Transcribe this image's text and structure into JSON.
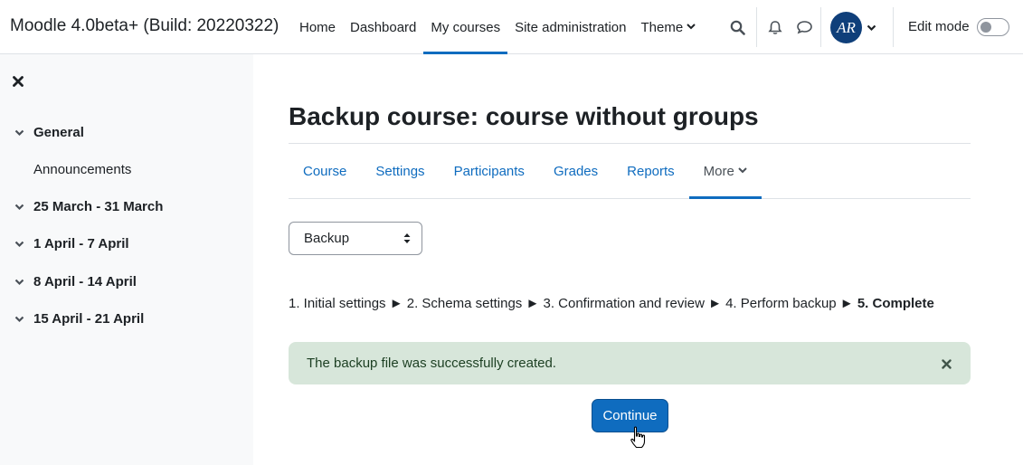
{
  "site": {
    "brand": "Moodle 4.0beta+ (Build: 20220322)"
  },
  "primary_nav": {
    "home": "Home",
    "dashboard": "Dashboard",
    "my_courses": "My courses",
    "site_admin": "Site administration",
    "theme": "Theme"
  },
  "user": {
    "initials": "AR",
    "edit_mode_label": "Edit mode",
    "edit_mode_on": false
  },
  "drawer": {
    "sections": {
      "general": "General",
      "announcements": "Announcements",
      "week1": "25 March - 31 March",
      "week2": "1 April - 7 April",
      "week3": "8 April - 14 April",
      "week4": "15 April - 21 April"
    }
  },
  "page": {
    "title": "Backup course: course without groups",
    "secondary_nav": {
      "course": "Course",
      "settings": "Settings",
      "participants": "Participants",
      "grades": "Grades",
      "reports": "Reports",
      "more": "More"
    },
    "select_value": "Backup",
    "steps": {
      "s1": "1. Initial settings ► 2. Schema settings ► 3. Confirmation and review ► 4. Perform backup ►",
      "s5": "5. Complete"
    },
    "alert": "The backup file was successfully created.",
    "continue_button": "Continue"
  },
  "colors": {
    "accent": "#0f6cbf",
    "success_bg": "#d7e6da",
    "drawer_bg": "#f8f9fa"
  }
}
